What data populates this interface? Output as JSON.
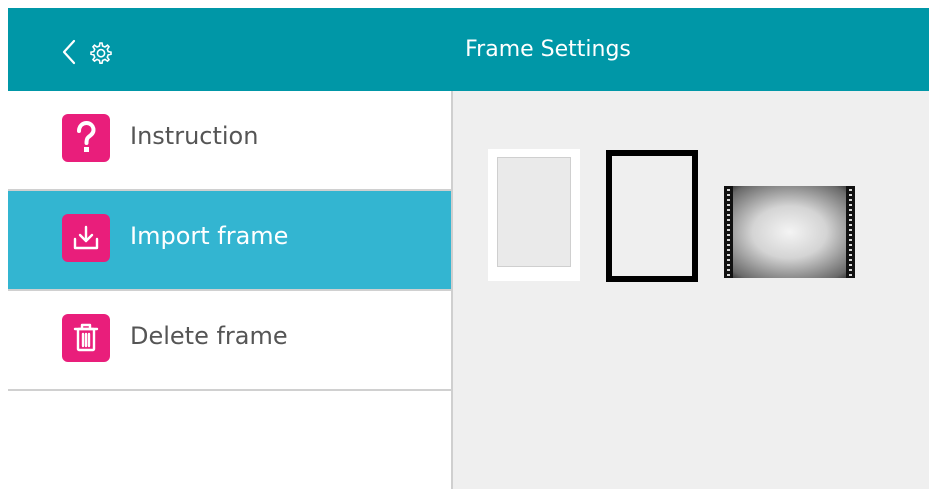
{
  "header": {
    "title": "Frame Settings"
  },
  "icons": {
    "back": "chevron-left-icon",
    "settings": "gear-icon",
    "instruction": "question-icon",
    "import": "download-icon",
    "delete": "trash-icon"
  },
  "colors": {
    "header_bg": "#0097a7",
    "active_item_bg": "#33b5d1",
    "icon_bg": "#e91e7b",
    "content_bg": "#efefef"
  },
  "menu": {
    "items": [
      {
        "label": "Instruction",
        "active": false
      },
      {
        "label": "Import frame",
        "active": true
      },
      {
        "label": "Delete frame",
        "active": false
      }
    ]
  },
  "frames": [
    {
      "style": "white-border"
    },
    {
      "style": "black-border"
    },
    {
      "style": "film-strip"
    }
  ]
}
